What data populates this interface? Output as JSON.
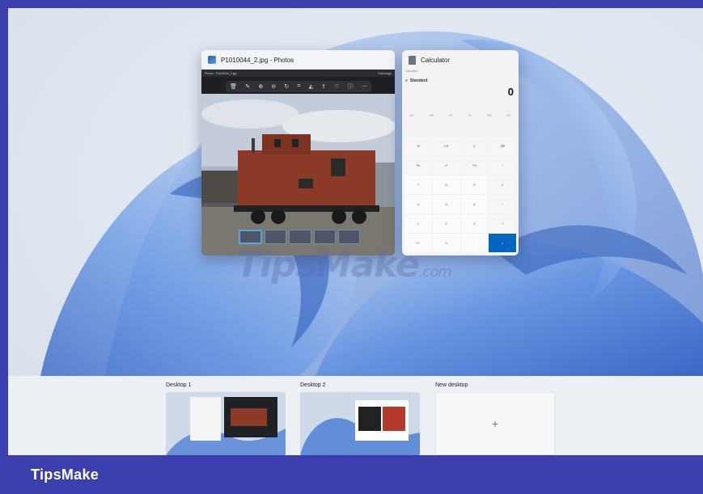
{
  "photos_window": {
    "title": "P1010044_2.jpg - Photos",
    "path_text": "Photos - P1010044_2.jpg",
    "edit_label": "Edit image",
    "toolbar_icons": [
      "delete-icon",
      "edit-icon",
      "zoom-in-icon",
      "zoom-out-icon",
      "rotate-icon",
      "crop-icon",
      "adjust-icon",
      "share-icon",
      "favorite-icon",
      "info-icon",
      "more-icon"
    ]
  },
  "calculator_window": {
    "title": "Calculator",
    "inner_title": "Calculator",
    "mode": "Standard",
    "display": "0",
    "memory_row": [
      "MC",
      "MR",
      "M+",
      "M-",
      "MS",
      "M˅"
    ],
    "keys": [
      "%",
      "CE",
      "C",
      "⌫",
      "⅟x",
      "x²",
      "²√x",
      "÷",
      "7",
      "8",
      "9",
      "×",
      "4",
      "5",
      "6",
      "−",
      "1",
      "2",
      "3",
      "+",
      "+/−",
      "0",
      ".",
      "="
    ]
  },
  "desktops": [
    {
      "label": "Desktop 1"
    },
    {
      "label": "Desktop 2"
    },
    {
      "label": "New desktop",
      "add_symbol": "+"
    }
  ],
  "watermark": {
    "text": "TipsMake",
    "suffix": ".com"
  },
  "brand": "TipsMake",
  "colors": {
    "frame": "#3b3fae",
    "accent": "#0067c0",
    "wallpaper": "#4f7fd6"
  }
}
